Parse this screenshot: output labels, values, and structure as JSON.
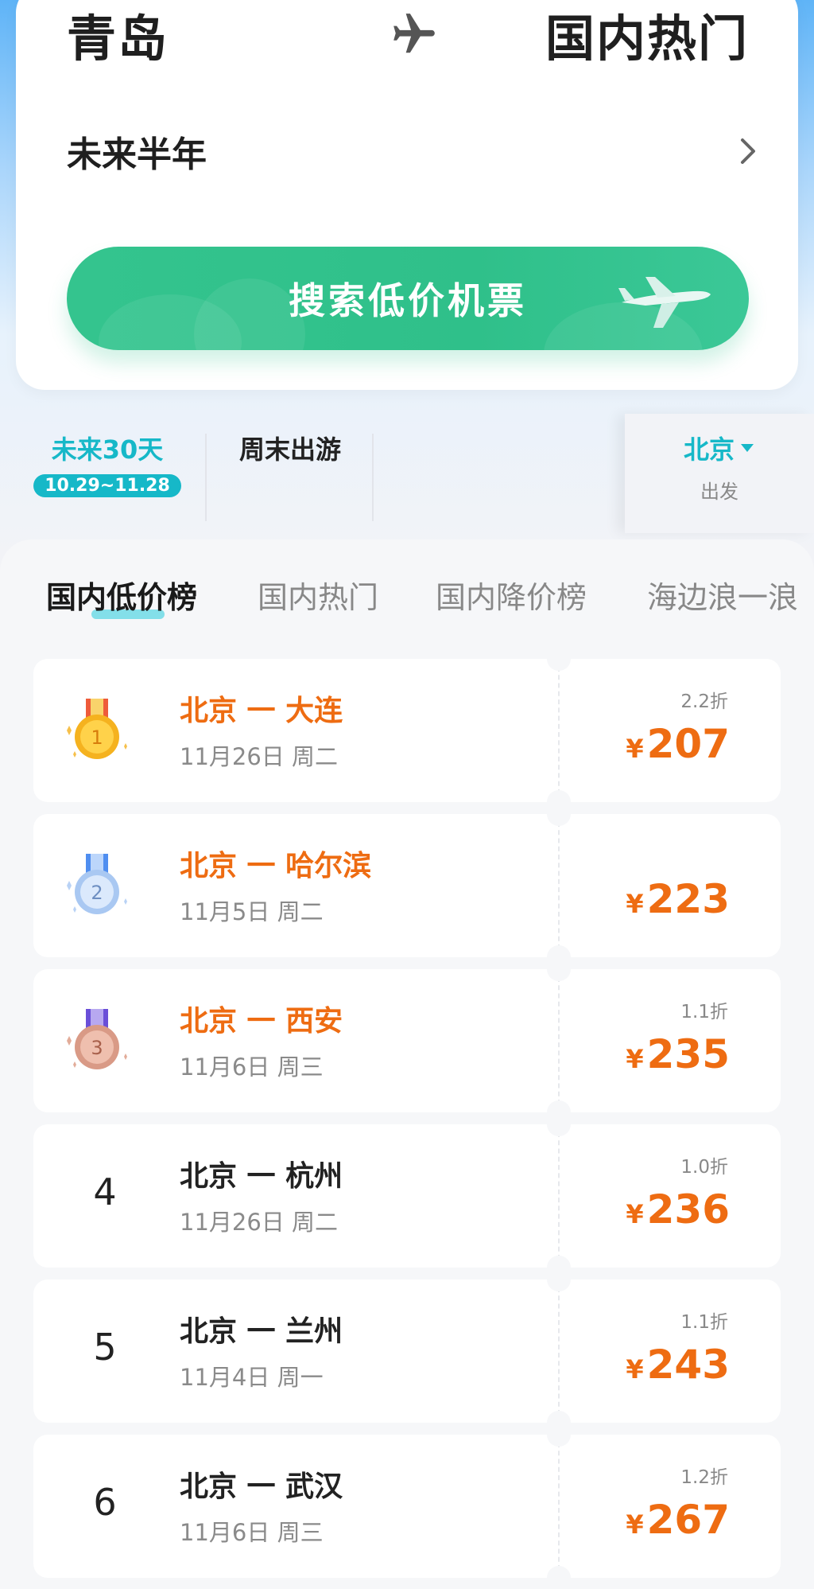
{
  "search": {
    "from_city": "青岛",
    "to_city": "国内热门",
    "date_range": "未来半年",
    "search_button": "搜索低价机票"
  },
  "filters": {
    "tab1_label": "未来30天",
    "tab1_range": "10.29~11.28",
    "tab2_label": "周末出游",
    "depart_city": "北京",
    "depart_label": "出发"
  },
  "list_tabs": [
    "国内低价榜",
    "国内热门",
    "国内降价榜",
    "海边浪一浪"
  ],
  "rankings": [
    {
      "rank": "1",
      "route": "北京 一 大连",
      "date": "11月26日 周二",
      "discount": "2.2折",
      "currency": "¥",
      "price": "207"
    },
    {
      "rank": "2",
      "route": "北京 一 哈尔滨",
      "date": "11月5日 周二",
      "discount": "",
      "currency": "¥",
      "price": "223"
    },
    {
      "rank": "3",
      "route": "北京 一 西安",
      "date": "11月6日 周三",
      "discount": "1.1折",
      "currency": "¥",
      "price": "235"
    },
    {
      "rank": "4",
      "route": "北京 一 杭州",
      "date": "11月26日 周二",
      "discount": "1.0折",
      "currency": "¥",
      "price": "236"
    },
    {
      "rank": "5",
      "route": "北京 一 兰州",
      "date": "11月4日 周一",
      "discount": "1.1折",
      "currency": "¥",
      "price": "243"
    },
    {
      "rank": "6",
      "route": "北京 一 武汉",
      "date": "11月6日 周三",
      "discount": "1.2折",
      "currency": "¥",
      "price": "267"
    }
  ],
  "colors": {
    "accent_teal": "#16b8c8",
    "button_green": "#34c48e",
    "price_orange": "#ee6c12",
    "medal_gold": "#f5b21f",
    "medal_silver": "#a9c8f2",
    "medal_bronze": "#d99a86"
  },
  "icons": {
    "plane": "plane-icon",
    "chevron": "chevron-right-icon",
    "caret": "caret-down-icon",
    "medals": [
      "gold-medal-icon",
      "silver-medal-icon",
      "bronze-medal-icon"
    ]
  }
}
